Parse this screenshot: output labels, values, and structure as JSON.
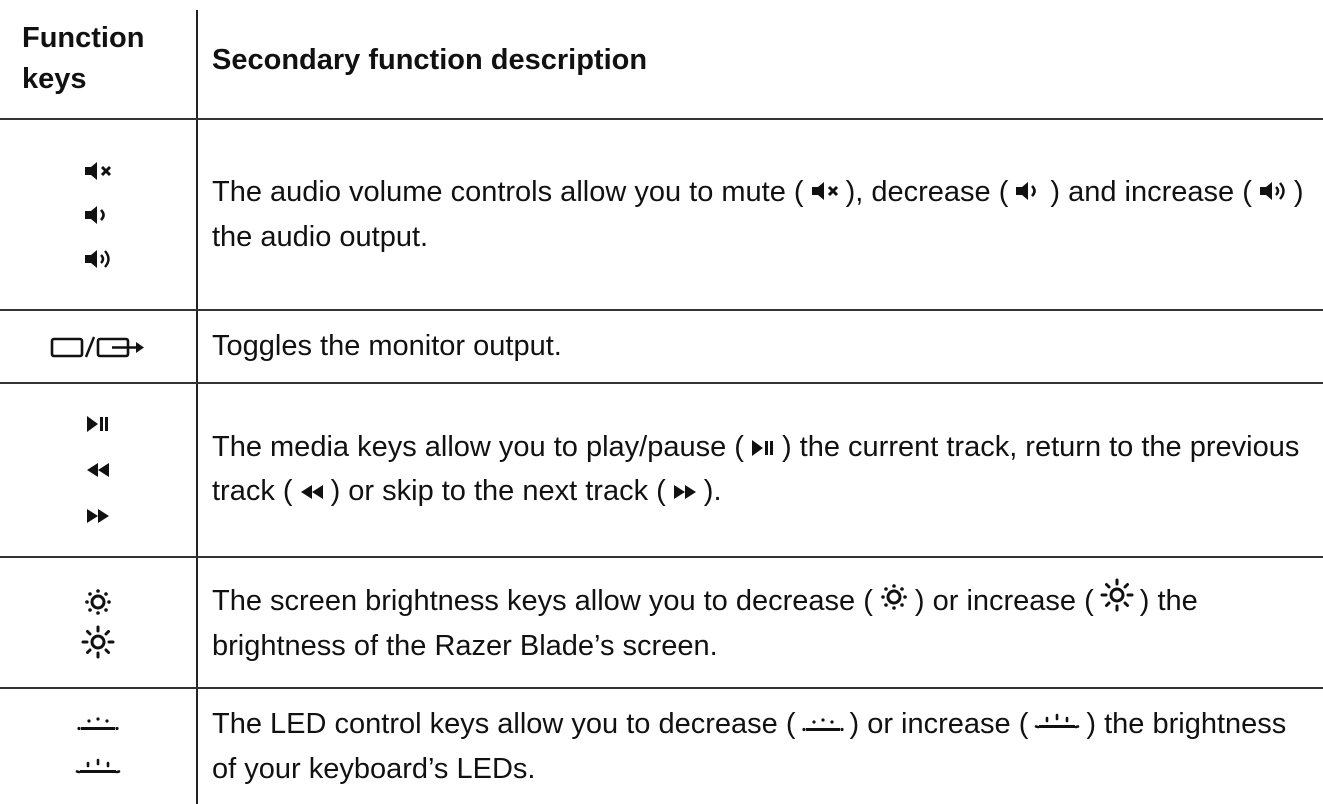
{
  "header": {
    "keys_label": "Function keys",
    "description_label": "Secondary function description"
  },
  "rows": [
    {
      "keys": [
        "mute-icon",
        "volume-down-icon",
        "volume-up-icon"
      ],
      "description": {
        "t1": "The audio volume controls allow you to mute (",
        "t2": "), decrease (",
        "t3": ") and increase (",
        "t4": ") the audio output."
      }
    },
    {
      "keys": [
        "monitor-toggle-icon"
      ],
      "description": {
        "t1": "Toggles the monitor output."
      }
    },
    {
      "keys": [
        "play-pause-icon",
        "previous-track-icon",
        "next-track-icon"
      ],
      "description": {
        "t1": "The media keys allow you to play/pause (",
        "t2": ") the current track, return to the previous track (",
        "t3": ") or skip to the next track (",
        "t4": ")."
      }
    },
    {
      "keys": [
        "brightness-down-icon",
        "brightness-up-icon"
      ],
      "description": {
        "t1": "The screen brightness keys allow you to decrease (",
        "t2": ") or increase (",
        "t3": ") the brightness of the Razer Blade’s screen."
      }
    },
    {
      "keys": [
        "led-down-icon",
        "led-up-icon"
      ],
      "description": {
        "t1": "The LED control keys allow you to decrease (",
        "t2": ") or increase (",
        "t3": ") the brightness of your keyboard’s LEDs."
      }
    }
  ]
}
